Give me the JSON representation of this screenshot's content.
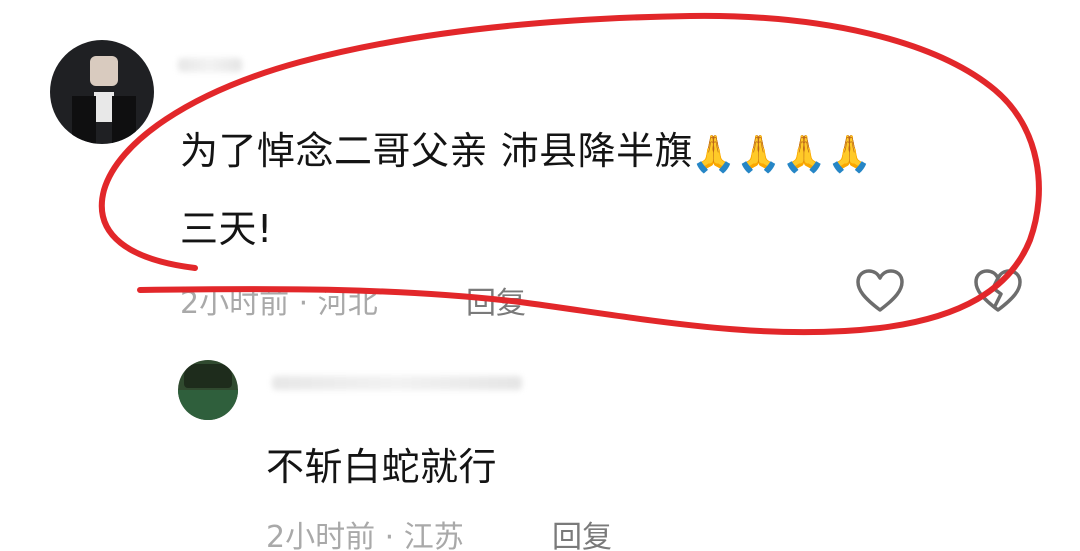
{
  "main_comment": {
    "text_line1": "为了悼念二哥父亲 沛县降半旗",
    "emoji": "🙏🙏🙏🙏",
    "text_line2": "三天!",
    "meta": "2小时前 · 河北",
    "reply_label": "回复"
  },
  "reply_comment": {
    "text": "不斩白蛇就行",
    "meta": "2小时前 · 江苏",
    "reply_label": "回复"
  },
  "colors": {
    "annotation_red": "#e2272a",
    "text_primary": "#141414",
    "text_meta": "#a9a9a9"
  },
  "icons": {
    "like": "heart-outline-icon",
    "dislike": "broken-heart-outline-icon"
  }
}
